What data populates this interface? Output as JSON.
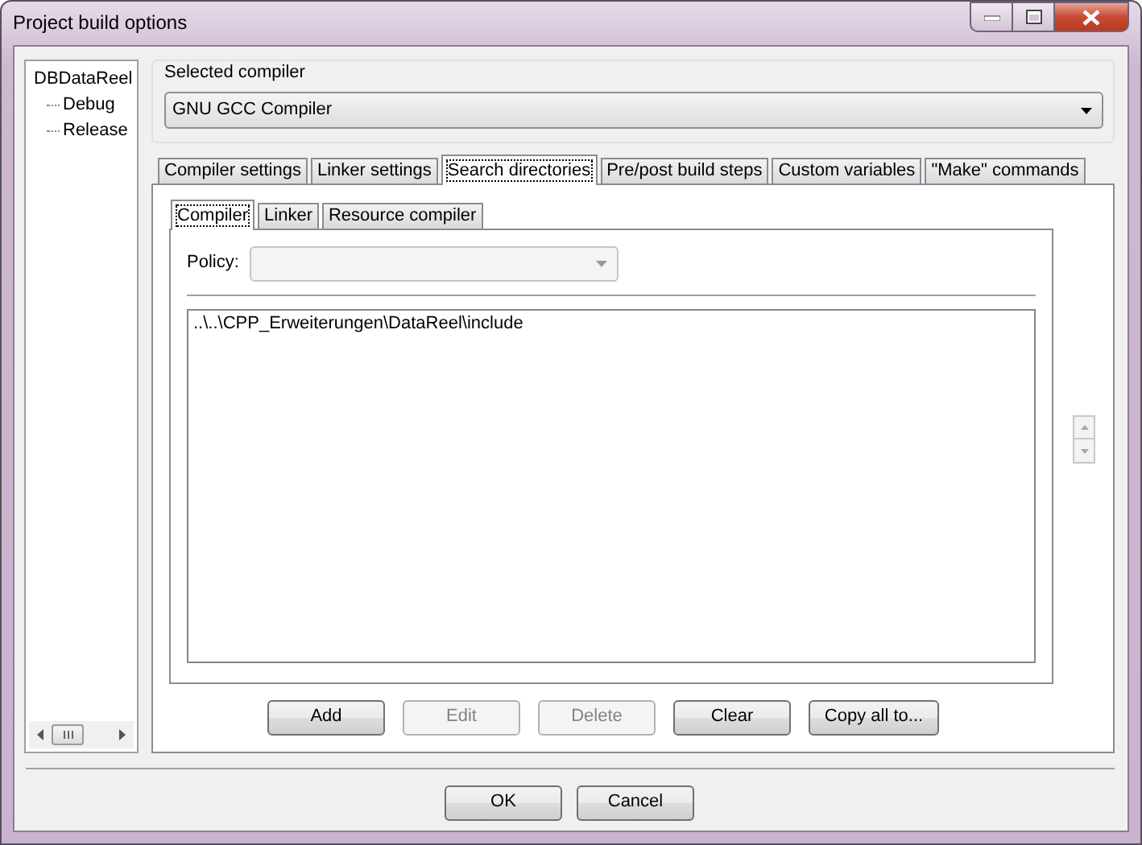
{
  "window": {
    "title": "Project build options"
  },
  "tree": {
    "items": [
      {
        "label": "DBDataReel",
        "children": [
          {
            "label": "Debug"
          },
          {
            "label": "Release"
          }
        ]
      }
    ]
  },
  "selected_compiler": {
    "label": "Selected compiler",
    "value": "GNU GCC Compiler"
  },
  "tabs": [
    {
      "label": "Compiler settings",
      "selected": false
    },
    {
      "label": "Linker settings",
      "selected": false
    },
    {
      "label": "Search directories",
      "selected": true
    },
    {
      "label": "Pre/post build steps",
      "selected": false
    },
    {
      "label": "Custom variables",
      "selected": false
    },
    {
      "label": "\"Make\" commands",
      "selected": false
    }
  ],
  "inner_tabs": [
    {
      "label": "Compiler",
      "selected": true
    },
    {
      "label": "Linker",
      "selected": false
    },
    {
      "label": "Resource compiler",
      "selected": false
    }
  ],
  "policy": {
    "label": "Policy:",
    "disabled": true
  },
  "directories": [
    "..\\..\\CPP_Erweiterungen\\DataReel\\include"
  ],
  "buttons": [
    {
      "label": "Add",
      "disabled": false
    },
    {
      "label": "Edit",
      "disabled": true
    },
    {
      "label": "Delete",
      "disabled": true
    },
    {
      "label": "Clear",
      "disabled": false
    },
    {
      "label": "Copy all to...",
      "disabled": false
    }
  ],
  "dialog_buttons": [
    {
      "label": "OK"
    },
    {
      "label": "Cancel"
    }
  ]
}
